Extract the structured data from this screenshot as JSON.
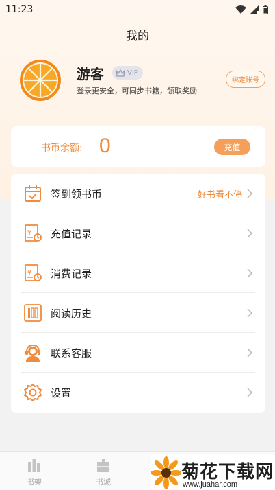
{
  "status_bar": {
    "time": "11:23",
    "icons": [
      "wifi-icon",
      "signal-icon",
      "battery-icon"
    ]
  },
  "header": {
    "title": "我的"
  },
  "profile": {
    "avatar_icon": "orange-slice-icon",
    "username": "游客",
    "vip_label": "VIP",
    "login_tip": "登录更安全，可同步书籍，领取奖励",
    "bind_button": "绑定账号"
  },
  "wallet": {
    "label": "书币余额:",
    "balance": "0",
    "recharge_button": "充值"
  },
  "menu": {
    "items": [
      {
        "label": "签到领书币",
        "extra": "好书看不停",
        "icon": "calendar-check-icon"
      },
      {
        "label": "充值记录",
        "extra": "",
        "icon": "recharge-record-icon"
      },
      {
        "label": "消费记录",
        "extra": "",
        "icon": "consume-record-icon"
      },
      {
        "label": "阅读历史",
        "extra": "",
        "icon": "reading-history-icon"
      },
      {
        "label": "联系客服",
        "extra": "",
        "icon": "customer-service-icon"
      },
      {
        "label": "设置",
        "extra": "",
        "icon": "settings-gear-icon"
      }
    ]
  },
  "bottom_nav": {
    "items": [
      {
        "label": "书架",
        "icon": "bookshelf-icon"
      },
      {
        "label": "书城",
        "icon": "bookstore-icon"
      }
    ]
  },
  "watermark": {
    "title": "菊花下载网",
    "url": "www.juahar.com"
  },
  "colors": {
    "accent": "#f08a3c",
    "accent_button": "#f5a05a",
    "header_bg": "#fff5ec",
    "page_bg": "#f2f2f2"
  }
}
